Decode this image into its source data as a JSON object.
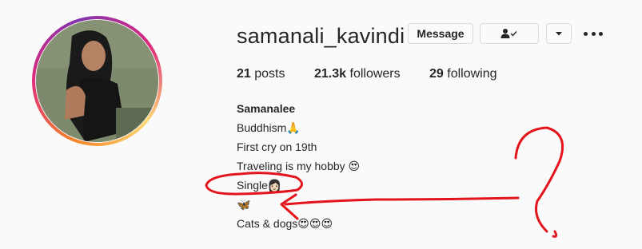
{
  "profile": {
    "username": "samanali_kavindi",
    "actions": {
      "message_label": "Message",
      "following_icon": "person-check-icon",
      "dropdown_icon": "chevron-down-icon",
      "more_icon": "more-options-icon"
    },
    "stats": {
      "posts_count": "21",
      "posts_label": "posts",
      "followers_count": "21.3k",
      "followers_label": "followers",
      "following_count": "29",
      "following_label": "following"
    },
    "bio": {
      "name": "Samanalee",
      "lines": [
        "Buddhism🙏",
        "First cry on 19th",
        "Traveling is my hobby 😍",
        "Single👩🏻",
        "🦋",
        "Cats & dogs😍😍😍"
      ]
    }
  },
  "colors": {
    "text": "#262626",
    "border": "#dbdbdb",
    "background": "#fafafa",
    "annotation_red": "#e3141b",
    "story_ring_start": "#f58529",
    "story_ring_end": "#dd2a7b"
  }
}
